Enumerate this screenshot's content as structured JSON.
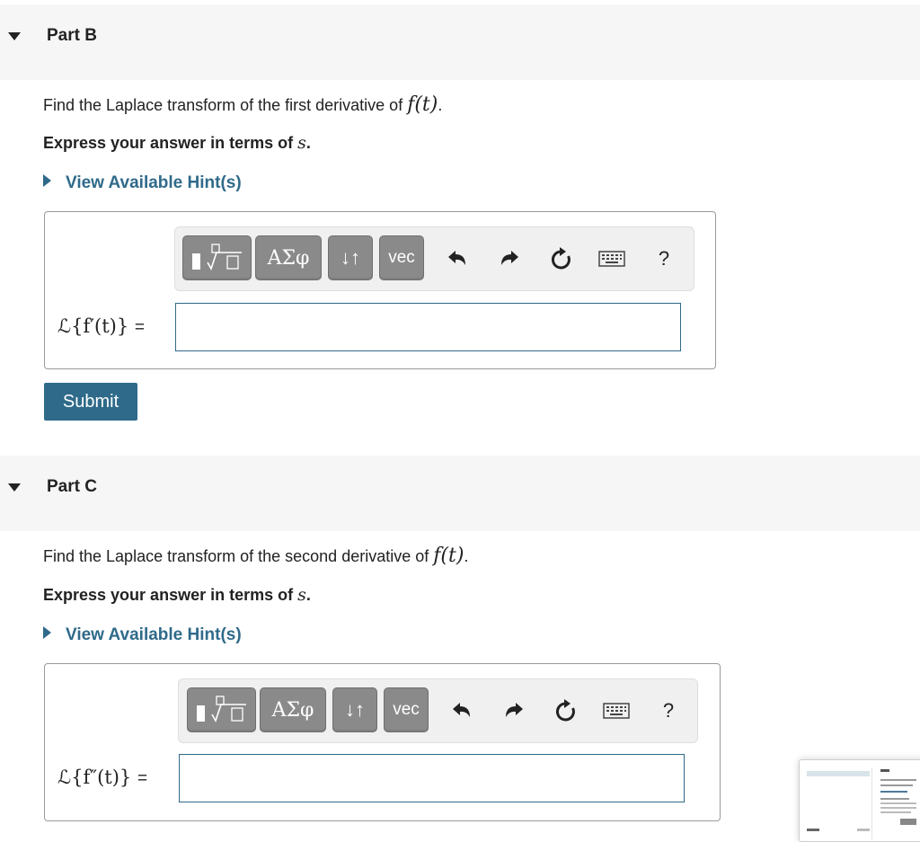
{
  "part_b": {
    "title": "Part B",
    "question_prefix": "Find the Laplace transform of the first derivative of ",
    "question_math": "f(t)",
    "question_suffix": ".",
    "express_prefix": "Express your answer in terms of ",
    "express_var": "s",
    "express_suffix": ".",
    "hint_label": "View Available Hint(s)",
    "equation_label": "ℒ{f′(t)}",
    "equals": "=",
    "input_value": "",
    "submit_label": "Submit"
  },
  "part_c": {
    "title": "Part C",
    "question_prefix": "Find the Laplace transform of the second derivative of ",
    "question_math": "f(t)",
    "question_suffix": ".",
    "express_prefix": "Express your answer in terms of ",
    "express_var": "s",
    "express_suffix": ".",
    "hint_label": "View Available Hint(s)",
    "equation_label": "ℒ{f″(t)}",
    "equals": "=",
    "input_value": ""
  },
  "toolbar": {
    "greek_label": "ΑΣφ",
    "arrows_label": "↓↑",
    "vec_label": "vec",
    "help_label": "?"
  },
  "icons": {
    "templates": "templates-icon",
    "undo": "undo-icon",
    "redo": "redo-icon",
    "reset": "reset-icon",
    "keyboard": "keyboard-icon",
    "caret": "caret-down-icon",
    "hint": "caret-right-icon"
  },
  "colors": {
    "accent": "#2f6a8a",
    "toolbar_button": "#8a8a8a",
    "header_bg": "#f6f6f6"
  }
}
